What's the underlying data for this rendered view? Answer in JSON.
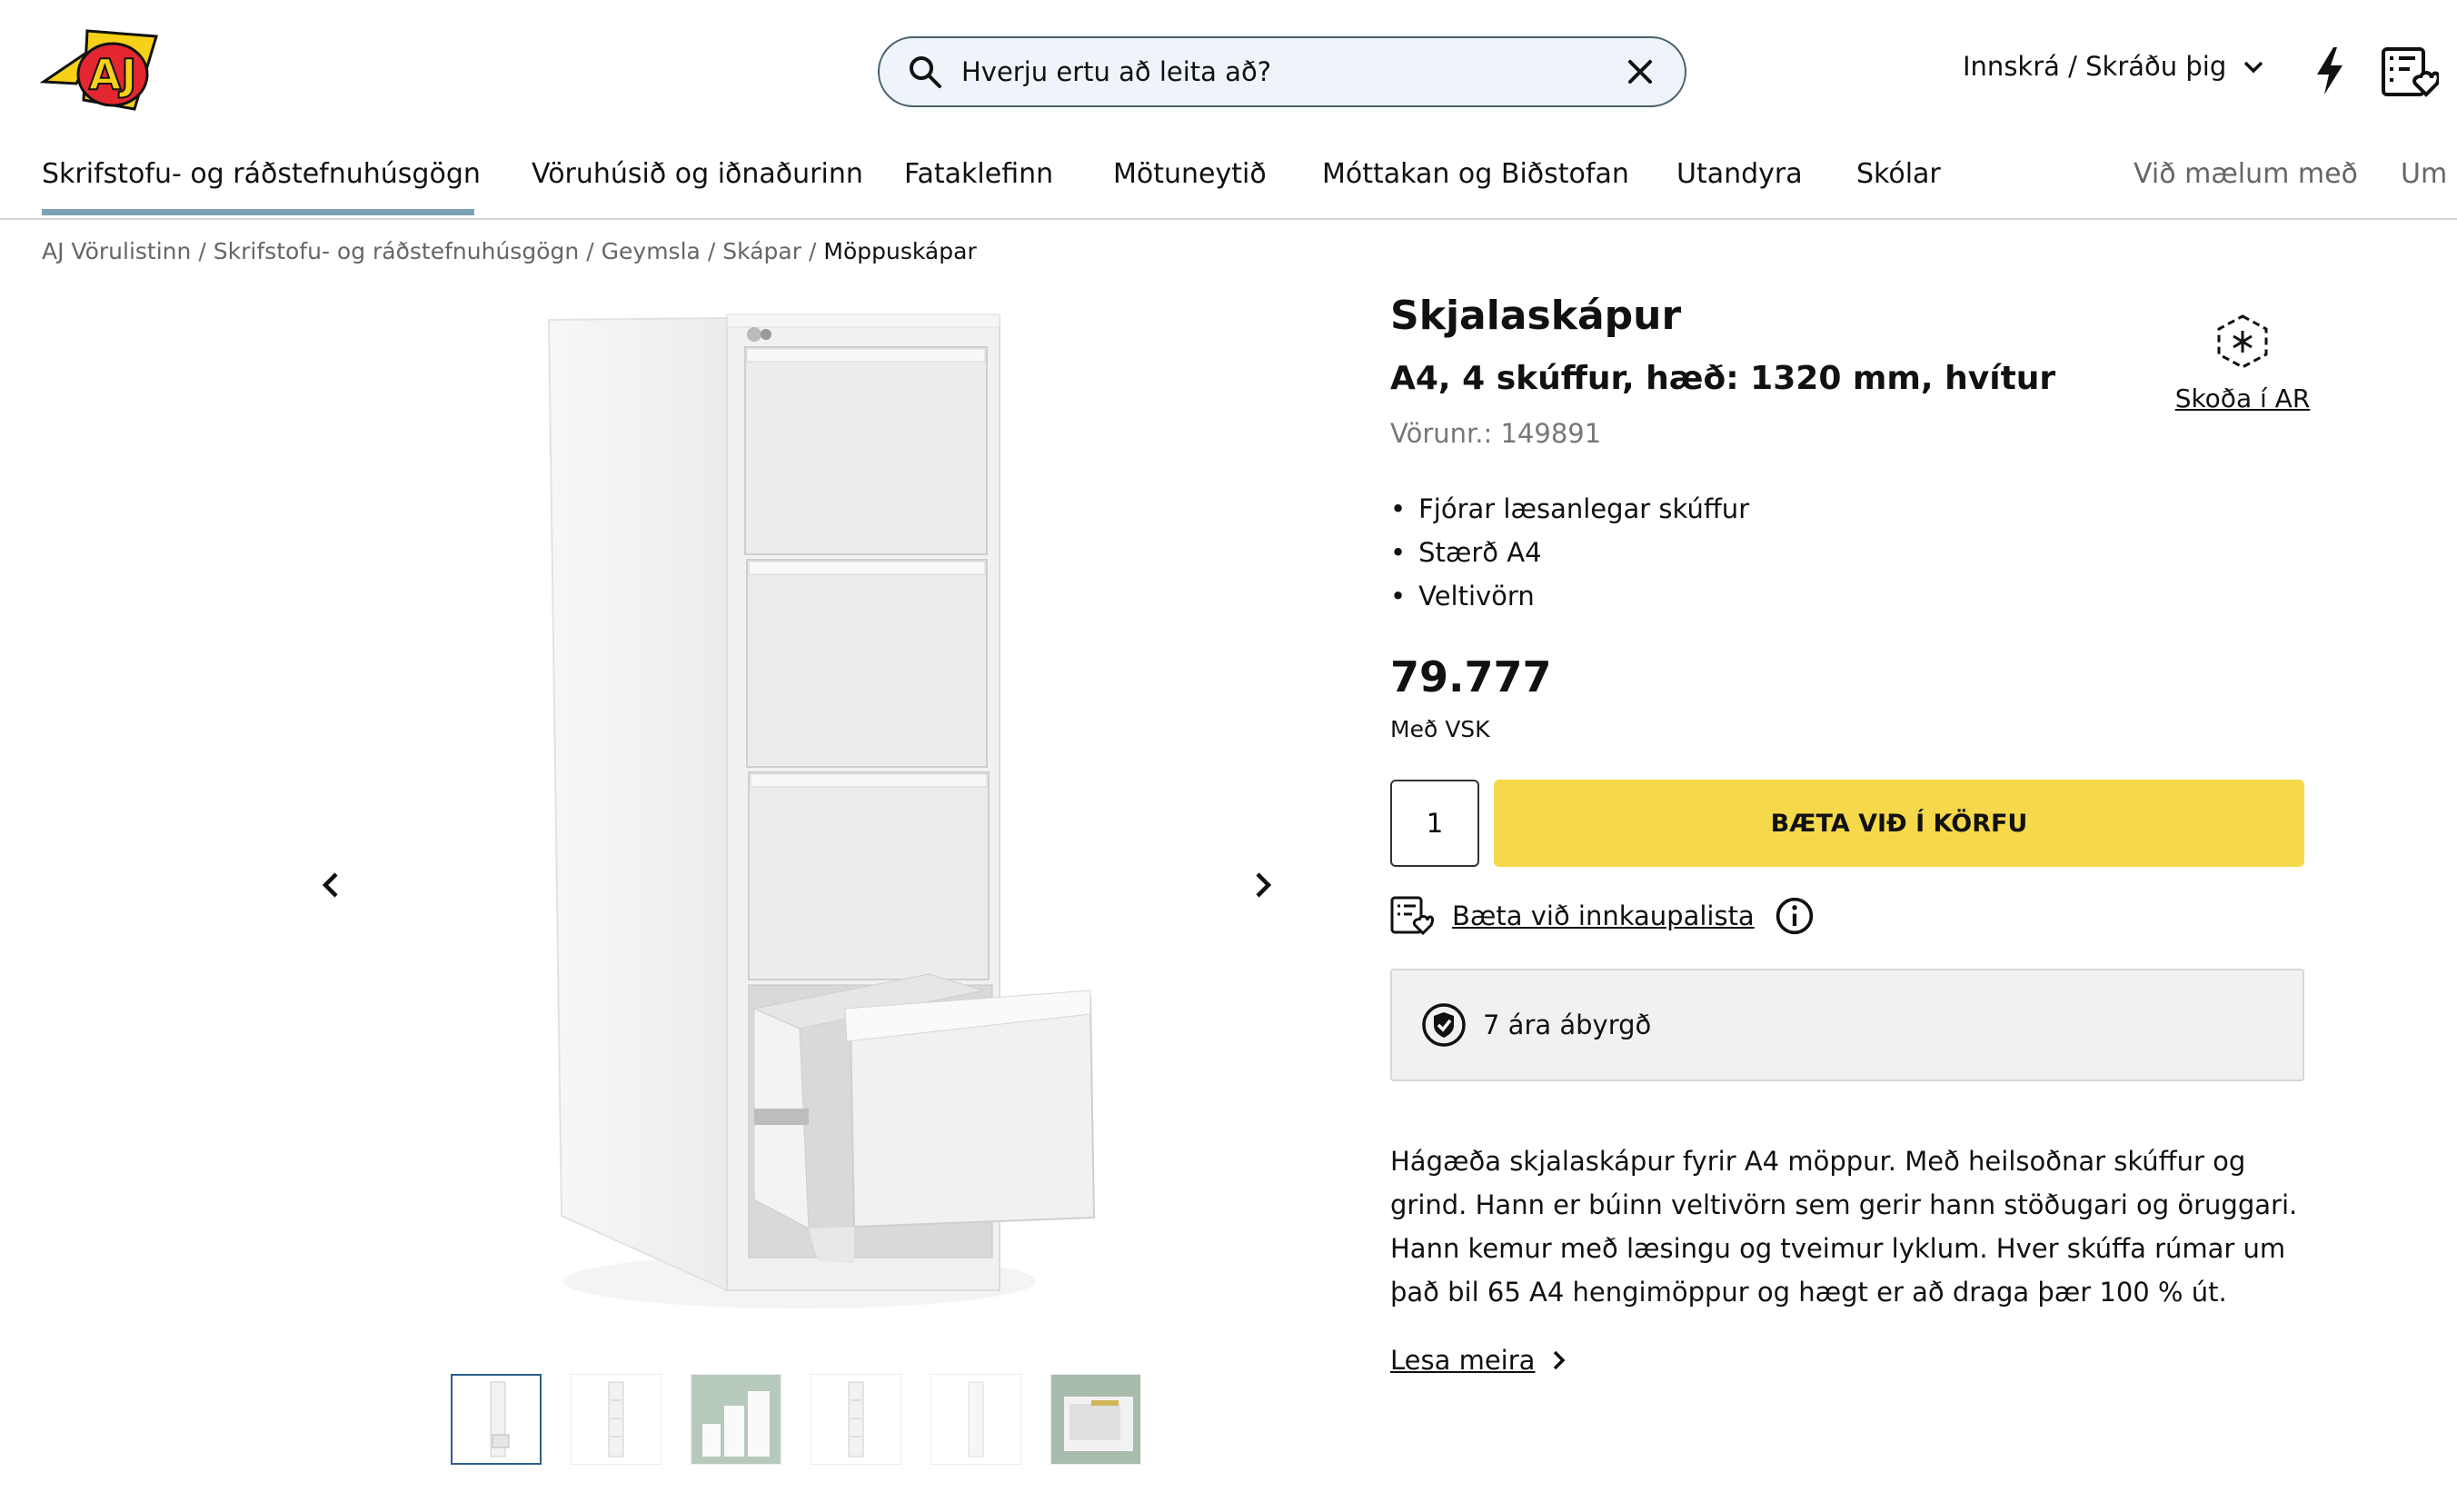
{
  "header": {
    "logo_text": "AJ",
    "search_placeholder": "Hverju ertu að leita að?",
    "login_label": "Innskrá / Skráðu þig"
  },
  "nav": {
    "items": [
      {
        "label": "Skrifstofu- og ráðstefnuhúsgögn",
        "active": true
      },
      {
        "label": "Vöruhúsið og iðnaðurinn"
      },
      {
        "label": "Fataklefinn"
      },
      {
        "label": "Mötuneytið"
      },
      {
        "label": "Móttakan og Biðstofan"
      },
      {
        "label": "Utandyra"
      },
      {
        "label": "Skólar"
      },
      {
        "label": "Við mælum með"
      },
      {
        "label": "Um o"
      }
    ]
  },
  "breadcrumb": [
    "AJ Vörulistinn",
    "Skrifstofu- og ráðstefnuhúsgögn",
    "Geymsla",
    "Skápar",
    "Möppuskápar"
  ],
  "product": {
    "title": "Skjalaskápur",
    "subtitle": "A4, 4 skúffur, hæð: 1320 mm, hvítur",
    "sku": "Vörunr.: 149891",
    "ar_label": "Skoða í AR",
    "bullets": [
      "Fjórar læsanlegar skúffur",
      "Stærð A4",
      "Veltivörn"
    ],
    "price": "79.777",
    "vat_label": "Með VSK",
    "quantity": "1",
    "add_to_cart": "BÆTA VIÐ Í KÖRFU",
    "wishlist_label": "Bæta við innkaupalista",
    "warranty": "7 ára ábyrgð",
    "description": "Hágæða skjalaskápur fyrir A4 möppur. Með heilsoðnar skúffur og grind. Hann er búinn veltivörn sem gerir hann stöðugari og öruggari. Hann kemur með læsingu og tveimur lyklum. Hver skúffa rúmar um það bil 65 A4 hengimöppur og hægt er að draga þær 100 % út.",
    "read_more": "Lesa meira"
  },
  "gallery": {
    "thumbnail_count": 6,
    "selected_index": 0
  },
  "colors": {
    "accent_yellow": "#f5d94a",
    "nav_underline": "#7ea2b5",
    "search_bg": "#eef4f9",
    "logo_red": "#e3262f",
    "logo_yellow": "#f7d117"
  }
}
